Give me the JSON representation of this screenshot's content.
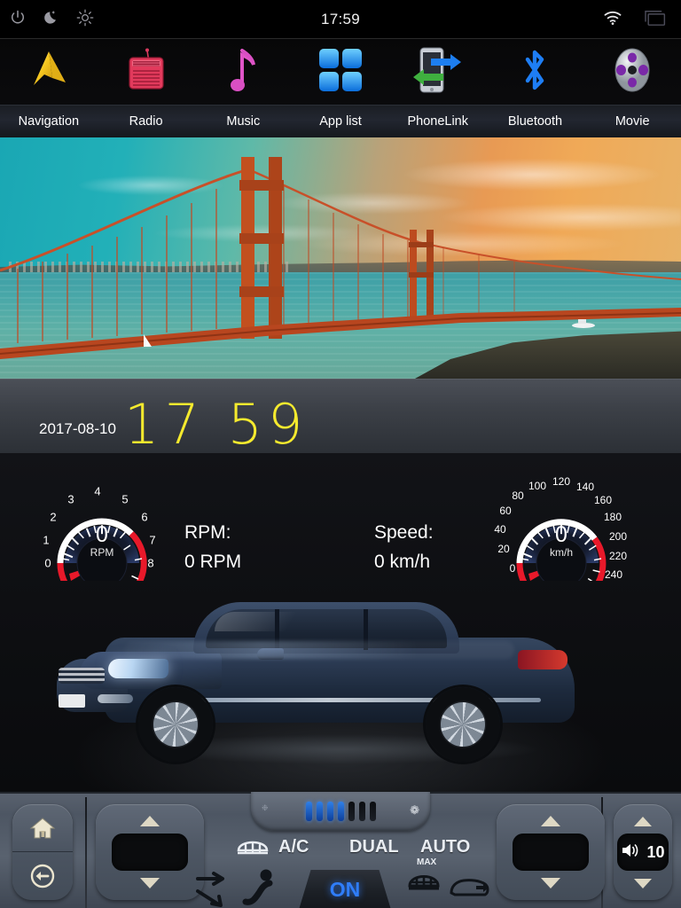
{
  "statusbar": {
    "time": "17:59",
    "icons_left": [
      "power-icon",
      "night-mode-icon",
      "brightness-icon"
    ],
    "icons_right": [
      "wifi-icon",
      "screen-cast-icon"
    ]
  },
  "appbar": {
    "items": [
      {
        "label": "Navigation",
        "icon": "navigation-arrow-icon"
      },
      {
        "label": "Radio",
        "icon": "radio-icon"
      },
      {
        "label": "Music",
        "icon": "music-note-icon"
      },
      {
        "label": "App list",
        "icon": "app-grid-icon"
      },
      {
        "label": "PhoneLink",
        "icon": "phonelink-icon"
      },
      {
        "label": "Bluetooth",
        "icon": "bluetooth-icon"
      },
      {
        "label": "Movie",
        "icon": "film-reel-icon"
      }
    ]
  },
  "media": {
    "artwork_description": "Golden Gate Bridge at sunset",
    "controls": [
      {
        "name": "previous-track-button",
        "icon": "skip-previous-icon"
      },
      {
        "name": "play-pause-button",
        "icon": "play-pause-icon"
      },
      {
        "name": "next-track-button",
        "icon": "skip-next-icon"
      }
    ]
  },
  "clock": {
    "date": "2017-08-10",
    "time": "17 59",
    "time_color": "#f5ea2e"
  },
  "dashboard": {
    "rpm": {
      "label": "RPM:",
      "value_text": "0 RPM",
      "center_value": "0",
      "center_unit": "RPM",
      "ticks": [
        "0",
        "1",
        "2",
        "3",
        "4",
        "5",
        "6",
        "7",
        "8"
      ],
      "min": 0,
      "max": 8,
      "current": 0,
      "redzone_low_end": 1,
      "redzone_high_start": 6
    },
    "speed": {
      "label": "Speed:",
      "value_text": "0 km/h",
      "center_value": "0",
      "center_unit": "km/h",
      "ticks": [
        "0",
        "20",
        "40",
        "60",
        "80",
        "100",
        "120",
        "140",
        "160",
        "180",
        "200",
        "220",
        "240"
      ],
      "min": 0,
      "max": 240,
      "current": 0,
      "redzone_low_end": 30,
      "redzone_high_start": 180
    },
    "vehicle_image": "dark-blue-sedan"
  },
  "climate": {
    "home_label": "home-icon",
    "back_label": "back-icon",
    "temp_left_value": "",
    "temp_right_value": "",
    "fan_bars_total": 7,
    "fan_bars_active": 4,
    "ac_label": "A/C",
    "dual_label": "DUAL",
    "auto_label": "AUTO",
    "max_label": "MAX",
    "on_label": "ON",
    "on_color": "#2f7dfa",
    "volume_value": "10",
    "up_arrow": "▲",
    "down_arrow": "▼"
  },
  "chart_data": {
    "type": "gauge",
    "title": "Vehicle instrument cluster",
    "gauges": [
      {
        "name": "RPM",
        "unit": "RPM",
        "value": 0,
        "min": 0,
        "max": 8,
        "tick_step": 1,
        "tick_labels": [
          "0",
          "1",
          "2",
          "3",
          "4",
          "5",
          "6",
          "7",
          "8"
        ],
        "red_zones": [
          [
            0,
            1
          ],
          [
            6,
            8
          ]
        ],
        "normal_zone": [
          1,
          6
        ],
        "display_text": "0 RPM"
      },
      {
        "name": "Speed",
        "unit": "km/h",
        "value": 0,
        "min": 0,
        "max": 240,
        "tick_step": 20,
        "tick_labels": [
          "0",
          "20",
          "40",
          "60",
          "80",
          "100",
          "120",
          "140",
          "160",
          "180",
          "200",
          "220",
          "240"
        ],
        "red_zones": [
          [
            0,
            30
          ],
          [
            180,
            240
          ]
        ],
        "normal_zone": [
          30,
          180
        ],
        "display_text": "0 km/h"
      }
    ],
    "legend_position": "none",
    "grid": false
  }
}
